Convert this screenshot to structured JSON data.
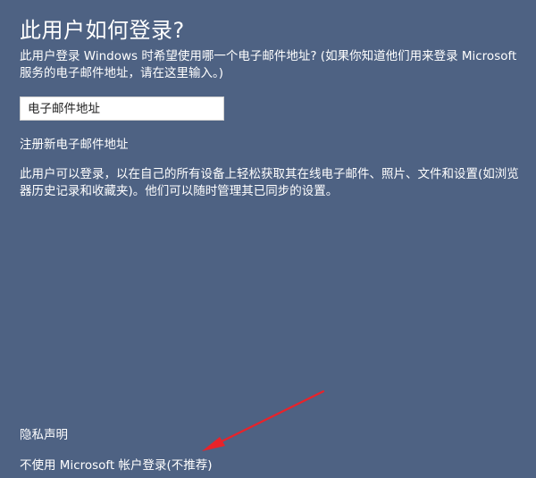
{
  "title": "此用户如何登录?",
  "intro": "此用户登录 Windows 时希望使用哪一个电子邮件地址? (如果你知道他们用来登录 Microsoft 服务的电子邮件地址，请在这里输入。)",
  "email_field": {
    "placeholder": "电子邮件地址",
    "value": ""
  },
  "register_link": "注册新电子邮件地址",
  "description": "此用户可以登录，以在自己的所有设备上轻松获取其在线电子邮件、照片、文件和设置(如浏览器历史记录和收藏夹)。他们可以随时管理其已同步的设置。",
  "footer": {
    "privacy_link": "隐私声明",
    "no_microsoft_link": "不使用 Microsoft 帐户登录(不推荐)"
  },
  "colors": {
    "background": "#4e6283",
    "text": "#ffffff",
    "annotation_arrow": "#e8232a"
  },
  "icons": {
    "annotation": "red-arrow-icon"
  }
}
